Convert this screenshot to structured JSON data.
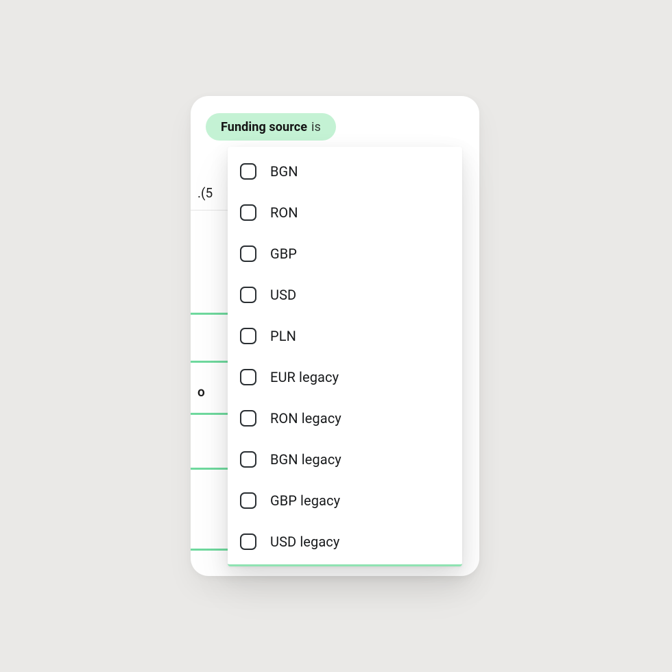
{
  "filter": {
    "label": "Funding source",
    "operator": "is"
  },
  "background": {
    "fragment_text": ".(5",
    "row_hints": [
      "",
      "",
      "o",
      "",
      ""
    ]
  },
  "options": [
    {
      "label": "BGN",
      "checked": false
    },
    {
      "label": "RON",
      "checked": false
    },
    {
      "label": "GBP",
      "checked": false
    },
    {
      "label": "USD",
      "checked": false
    },
    {
      "label": "PLN",
      "checked": false
    },
    {
      "label": "EUR legacy",
      "checked": false
    },
    {
      "label": "RON legacy",
      "checked": false
    },
    {
      "label": "BGN legacy",
      "checked": false
    },
    {
      "label": "GBP legacy",
      "checked": false
    },
    {
      "label": "USD legacy",
      "checked": false
    }
  ]
}
